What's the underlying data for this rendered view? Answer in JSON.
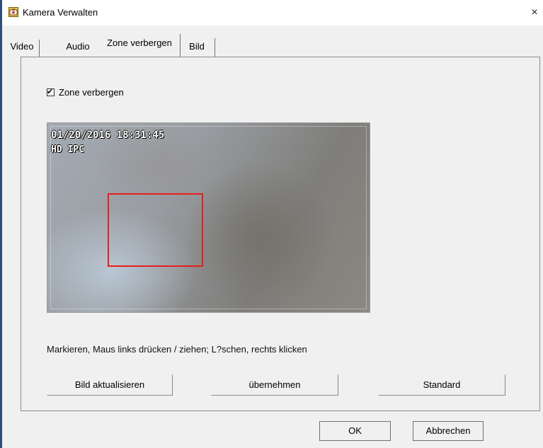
{
  "window": {
    "title": "Kamera Verwalten",
    "icon": "camera-app-icon",
    "close_glyph": "×"
  },
  "tabs": [
    {
      "label": "Video",
      "selected": false
    },
    {
      "label": "Audio",
      "selected": false
    },
    {
      "label": "Zone verbergen",
      "selected": true
    },
    {
      "label": "Bild",
      "selected": false
    }
  ],
  "privacy_zone": {
    "checkbox_label": "Zone verbergen",
    "checked": true,
    "check_glyph": "✔",
    "preview": {
      "timestamp": "01/20/2016 18:31:45",
      "camera_label": "HD IPC",
      "mask_color": "#e81e1e"
    },
    "instructions": "Markieren, Maus links drücken / ziehen; L?schen, rechts klicken"
  },
  "buttons": {
    "refresh": "Bild aktualisieren",
    "apply": "übernehmen",
    "standard": "Standard"
  },
  "dialog_buttons": {
    "ok": "OK",
    "cancel": "Abbrechen"
  }
}
